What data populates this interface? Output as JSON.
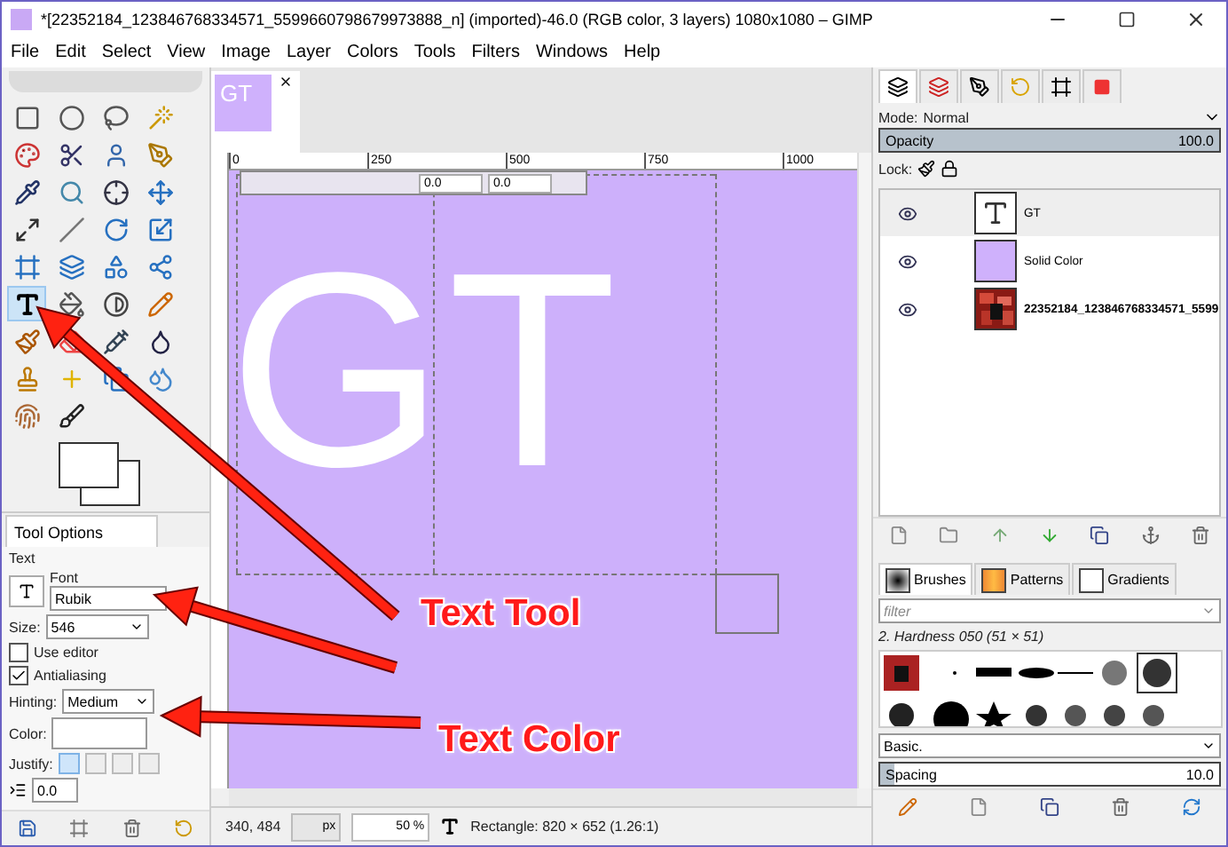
{
  "window": {
    "title": "*[22352184_123846768334571_5599660798679973888_n] (imported)-46.0 (RGB color, 3 layers) 1080x1080 – GIMP"
  },
  "menu": [
    "File",
    "Edit",
    "Select",
    "View",
    "Image",
    "Layer",
    "Colors",
    "Tools",
    "Filters",
    "Windows",
    "Help"
  ],
  "toolbox": {
    "tools": [
      {
        "selected": false
      },
      {
        "selected": false
      },
      {
        "selected": false
      },
      {
        "selected": false
      },
      {
        "selected": false
      },
      {
        "selected": false
      },
      {
        "selected": false
      },
      {
        "selected": false
      },
      {
        "selected": false
      },
      {
        "selected": false
      },
      {
        "selected": false
      },
      {
        "selected": false
      },
      {
        "selected": false
      },
      {
        "selected": false
      },
      {
        "selected": false
      },
      {
        "selected": false
      },
      {
        "selected": false
      },
      {
        "selected": false
      },
      {
        "selected": false
      },
      {
        "selected": false
      },
      {
        "selected": true
      },
      {
        "selected": false
      },
      {
        "selected": false
      },
      {
        "selected": false
      },
      {
        "selected": false
      },
      {
        "selected": false
      },
      {
        "selected": false
      },
      {
        "selected": false
      },
      {
        "selected": false
      },
      {
        "selected": false
      },
      {
        "selected": false
      },
      {
        "selected": false
      },
      {
        "selected": false
      },
      {
        "selected": false
      }
    ]
  },
  "tool_options": {
    "title": "Tool Options",
    "section": "Text",
    "font_label": "Font",
    "font_value": "Rubik",
    "size_label": "Size:",
    "size_value": "546",
    "use_editor": {
      "label": "Use editor",
      "checked": false
    },
    "antialiasing": {
      "label": "Antialiasing",
      "checked": true
    },
    "hinting_label": "Hinting:",
    "hinting_value": "Medium",
    "color_label": "Color:",
    "justify_label": "Justify:",
    "justify": [
      {
        "selected": true
      },
      {
        "selected": false
      },
      {
        "selected": false
      },
      {
        "selected": false
      }
    ],
    "indent_value": "0.0"
  },
  "image_tab": {
    "thumbnail_text": "GT"
  },
  "ruler": [
    "0",
    "250",
    "500",
    "750",
    "1000"
  ],
  "text_toolbar": {
    "values": [
      "0.0",
      "0.0"
    ]
  },
  "canvas": {
    "text": "GT"
  },
  "status_bar": {
    "coordinates": "340, 484",
    "unit": "px",
    "zoom": "50 %",
    "message": "Rectangle: 820 × 652  (1.26:1)"
  },
  "layers_panel": {
    "mode_label": "Mode:",
    "mode_value": "Normal",
    "opacity": {
      "label": "Opacity",
      "value": "100.0",
      "level": 1.0
    },
    "lock_label": "Lock:",
    "layers": [
      {
        "name": "GT",
        "kind": "text",
        "selected": true
      },
      {
        "name": "Solid Color",
        "kind": "color",
        "color": "#cfb1fc",
        "selected": false
      },
      {
        "name": "22352184_123846768334571_5599",
        "kind": "picture",
        "selected": false
      }
    ]
  },
  "brushes_panel": {
    "tabs": [
      {
        "label": "Brushes",
        "selected": true
      },
      {
        "label": "Patterns",
        "selected": false
      },
      {
        "label": "Gradients",
        "selected": false
      }
    ],
    "filter_placeholder": "filter",
    "brush_name": "2. Hardness 050 (51 × 51)",
    "preset": "Basic.",
    "spacing": {
      "label": "Spacing",
      "value": "10.0",
      "level": 0.04
    }
  },
  "annotations": [
    {
      "text": "Text Tool"
    },
    {
      "text": "Text Color"
    }
  ]
}
